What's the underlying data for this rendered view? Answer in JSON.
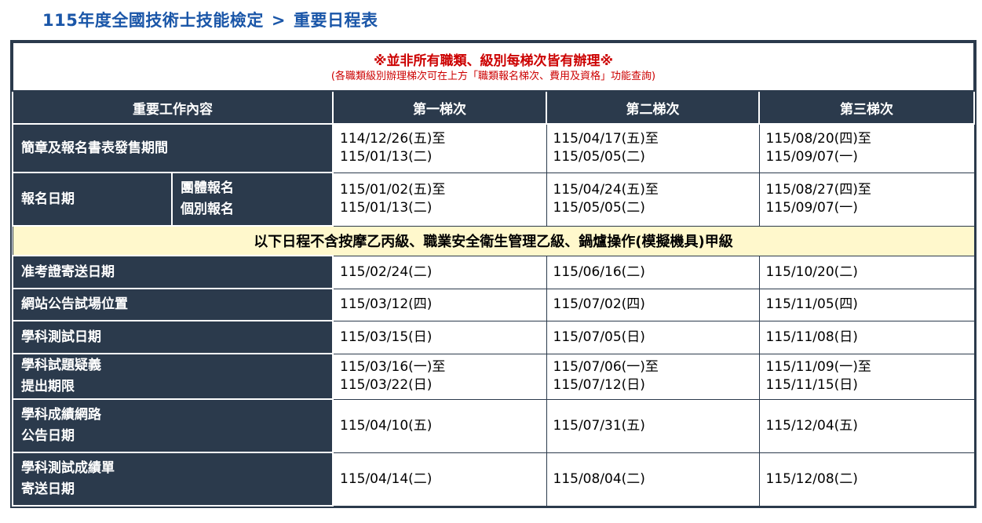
{
  "page": {
    "title_part1": "115年度全國技術士技能檢定",
    "separator": ">",
    "title_part2": "重要日程表"
  },
  "notice": {
    "main": "※並非所有職類、級別每梯次皆有辦理※",
    "sub": "(各職類級別辦理梯次可在上方「職類報名梯次、費用及資格」功能查詢)"
  },
  "header": {
    "item": "重要工作內容",
    "batch1": "第一梯次",
    "batch2": "第二梯次",
    "batch3": "第三梯次"
  },
  "band": "以下日程不含按摩乙丙級、職業安全衛生管理乙級、鍋爐操作(模擬機具)甲級",
  "rows": {
    "brochure": {
      "label": "簡章及報名書表發售期間",
      "b1": [
        "114/12/26(五)至",
        "115/01/13(二)"
      ],
      "b2": [
        "115/04/17(五)至",
        "115/05/05(二)"
      ],
      "b3": [
        "115/08/20(四)至",
        "115/09/07(一)"
      ]
    },
    "register": {
      "label": "報名日期",
      "sub1": "團體報名",
      "sub2": "個別報名",
      "b1": [
        "115/01/02(五)至",
        "115/01/13(二)"
      ],
      "b2": [
        "115/04/24(五)至",
        "115/05/05(二)"
      ],
      "b3": [
        "115/08/27(四)至",
        "115/09/07(一)"
      ]
    },
    "admission": {
      "label": "准考證寄送日期",
      "b1": "115/02/24(二)",
      "b2": "115/06/16(二)",
      "b3": "115/10/20(二)"
    },
    "venue": {
      "label": "網站公告試場位置",
      "b1": "115/03/12(四)",
      "b2": "115/07/02(四)",
      "b3": "115/11/05(四)"
    },
    "written": {
      "label": "學科測試日期",
      "b1": "115/03/15(日)",
      "b2": "115/07/05(日)",
      "b3": "115/11/08(日)"
    },
    "doubt": {
      "label1": "學科試題疑義",
      "label2": "提出期限",
      "b1": [
        "115/03/16(一)至",
        "115/03/22(日)"
      ],
      "b2": [
        "115/07/06(一)至",
        "115/07/12(日)"
      ],
      "b3": [
        "115/11/09(一)至",
        "115/11/15(日)"
      ]
    },
    "online": {
      "label1": "學科成績網路",
      "label2": "公告日期",
      "b1": "115/04/10(五)",
      "b2": "115/07/31(五)",
      "b3": "115/12/04(五)"
    },
    "mail": {
      "label1": "學科測試成績單",
      "label2": "寄送日期",
      "b1": "115/04/14(二)",
      "b2": "115/08/04(二)",
      "b3": "115/12/08(二)"
    }
  }
}
